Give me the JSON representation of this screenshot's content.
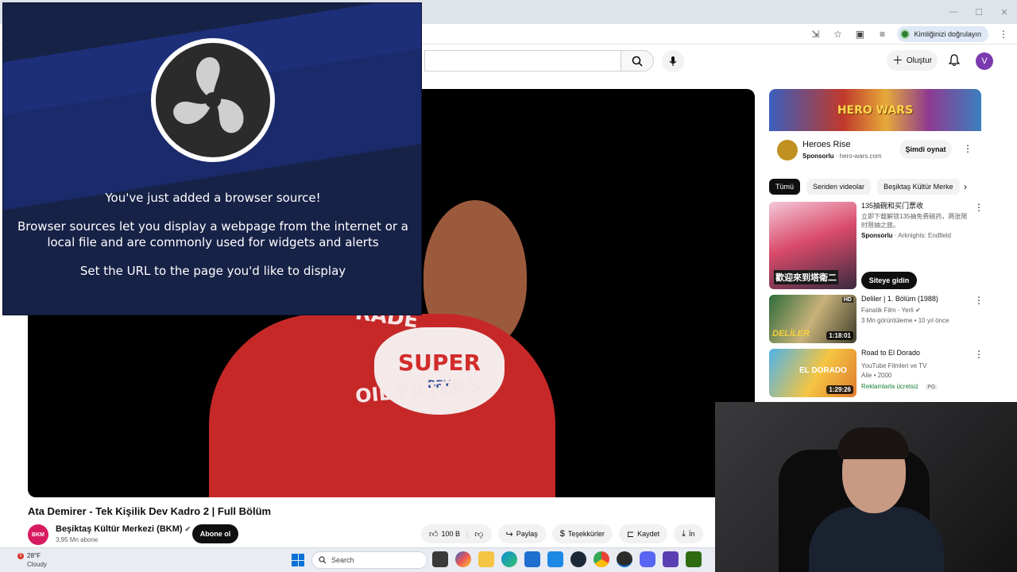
{
  "browser": {
    "verify_identity_label": "Kimliğinizi doğrulayın"
  },
  "youtube": {
    "header": {
      "create_label": "Oluştur",
      "avatar_letter": "V"
    },
    "video": {
      "title": "Ata Demirer - Tek Kişilik Dev Kadro 2 | Full Bölüm",
      "shirt_text_top": "RADE",
      "shirt_badge_main": "SUPER",
      "shirt_badge_sub": "DRY",
      "shirt_text_bottom": "OIL FILTERS"
    },
    "channel": {
      "avatar_text": "BKM",
      "name": "Beşiktaş Kültür Merkezi (BKM)",
      "subscribers": "3,95 Mn abone",
      "subscribe_label": "Abone ol"
    },
    "actions": {
      "like_count": "100 B",
      "share_label": "Paylaş",
      "thanks_label": "Teşekkürler",
      "save_label": "Kaydet",
      "download_label_partial": "İn"
    },
    "ad": {
      "banner_text": "HERO WARS",
      "title": "Heroes Rise",
      "sponsored_label": "Sponsorlu",
      "domain": "hero-wars.com",
      "cta_label": "Şimdi oynat"
    },
    "chips": [
      {
        "label": "Tümü"
      },
      {
        "label": "Seriden videolar"
      },
      {
        "label": "Beşiktaş Kültür Merke"
      }
    ],
    "recommendations": [
      {
        "title": "135抽碗和买门票收",
        "line1": "立即下载解锁135抽免费碗药，两张限",
        "line2": "时限抽之旅。",
        "line3_sponsored": "Sponsorlu",
        "line3_source": "Arknights: Endfield",
        "thumb_caption": "歡迎來到塔衛二",
        "cta_label": "Siteye gidin"
      },
      {
        "title": "Deliler | 1. Bölüm (1988)",
        "channel": "Fanatik Film - Yerli",
        "stats": "3 Mn görüntüleme • 10 yıl önce",
        "duration": "1:18:01",
        "badge": "HD",
        "thumb_caption": "DELİLER"
      },
      {
        "title": "Road to El Dorado",
        "channel": "YouTube Filmleri ve TV",
        "meta": "Aile • 2000",
        "free_label": "Reklamlarla ücretsiz",
        "rating": "PG",
        "duration": "1:29:26",
        "thumb_caption": "EL DORADO"
      }
    ]
  },
  "obs": {
    "line1": "You've just added a browser source!",
    "line2": "Browser sources let you display a webpage from the internet or a local file and are commonly used for widgets and alerts",
    "line3": "Set the URL to the page you'd like to display"
  },
  "taskbar": {
    "weather_badge": "5",
    "temperature": "28°F",
    "condition": "Cloudy",
    "search_placeholder": "Search"
  },
  "colors": {
    "obs_background": "#172247",
    "subscribe_button": "#0f0f0f",
    "channel_avatar": "#d81b60",
    "shirt": "#c62828"
  }
}
